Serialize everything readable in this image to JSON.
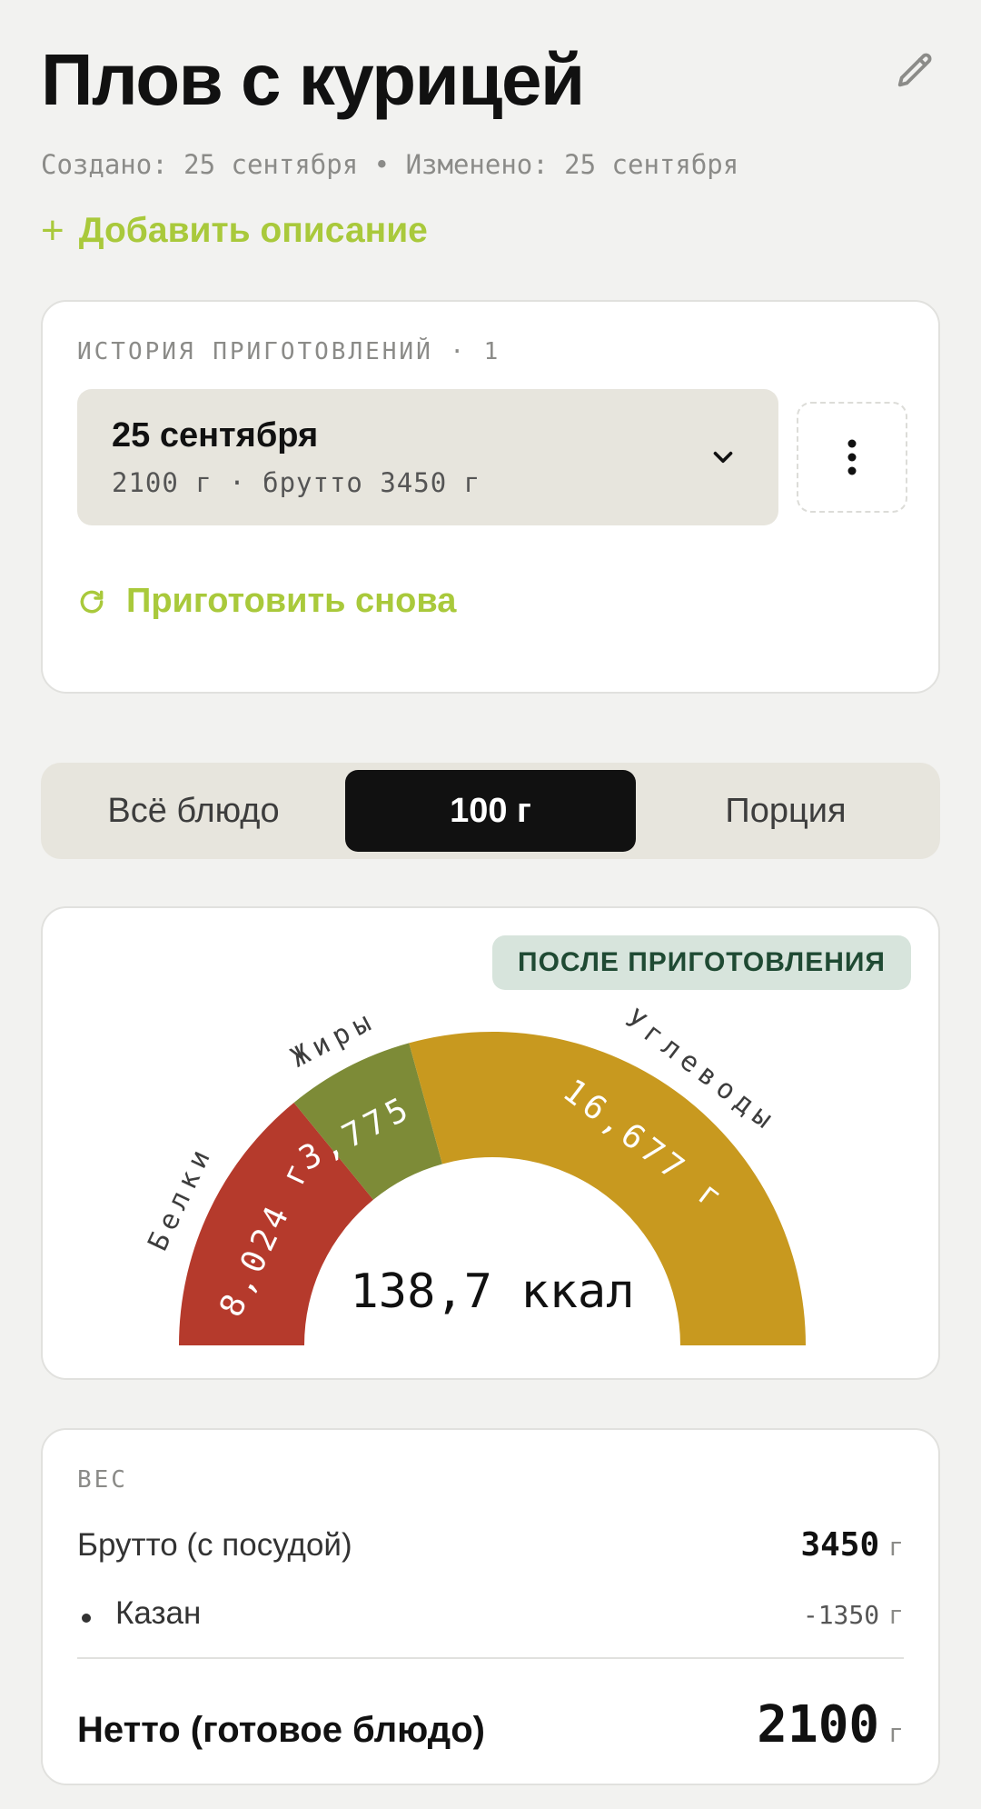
{
  "header": {
    "title": "Плов с курицей",
    "meta": "Создано: 25 сентября • Изменено: 25 сентября",
    "add_description": "Добавить описание",
    "edit_icon": "pencil-icon"
  },
  "history": {
    "label": "ИСТОРИЯ ПРИГОТОВЛЕНИЙ · 1",
    "entry": {
      "date": "25 сентября",
      "details": "2100 г · брутто 3450 г"
    },
    "cook_again": "Приготовить снова"
  },
  "tabs": [
    {
      "label": "Всё блюдо",
      "selected": false
    },
    {
      "label": "100 г",
      "selected": true
    },
    {
      "label": "Порция",
      "selected": false
    }
  ],
  "macros": {
    "badge": "ПОСЛЕ ПРИГОТОВЛЕНИЯ",
    "calories": "138,7 ккал",
    "segments": [
      {
        "name": "Белки",
        "value_label": "8,024 г",
        "value": 8.024,
        "color": "#b53a2c"
      },
      {
        "name": "Жиры",
        "value_label": "3,775 г",
        "value": 3.775,
        "color": "#7d8b37"
      },
      {
        "name": "Углеводы",
        "value_label": "16,677 г",
        "value": 16.677,
        "color": "#c8991f"
      }
    ]
  },
  "weight": {
    "label": "ВЕС",
    "gross_label": "Брутто (с посудой)",
    "gross_value": "3450",
    "vessel_label": "Казан",
    "vessel_value": "-1350",
    "net_label": "Нетто (готовое блюдо)",
    "net_value": "2100",
    "unit": "г"
  }
}
